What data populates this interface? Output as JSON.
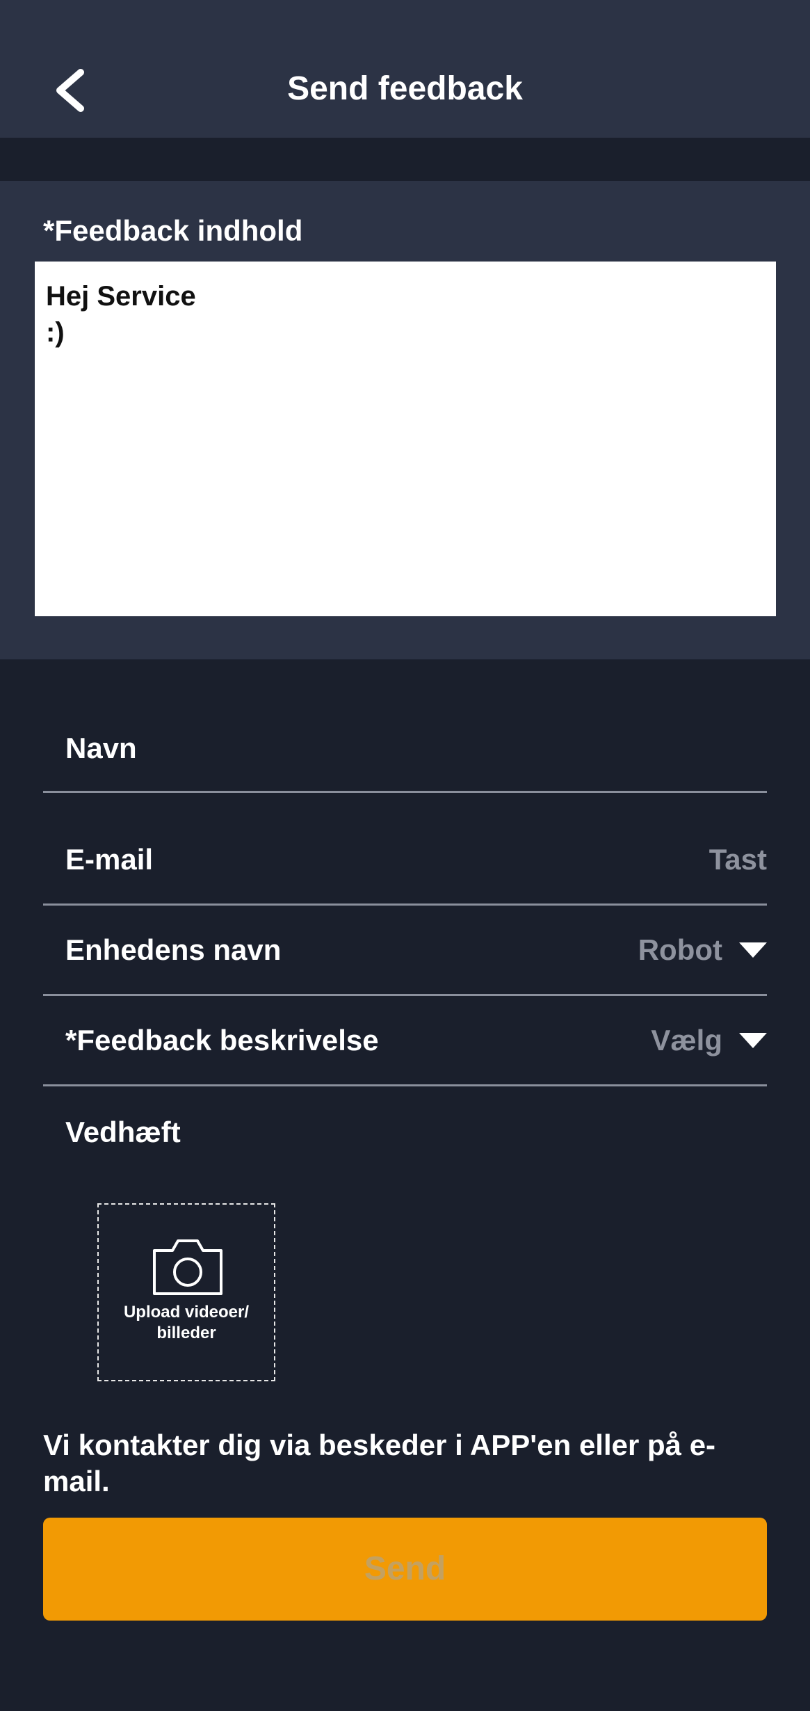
{
  "header": {
    "title": "Send feedback",
    "back_icon": "chevron-left-icon"
  },
  "feedback_content": {
    "label": "*Feedback indhold",
    "value": "Hej Service\n:)"
  },
  "form": {
    "name_label": "Navn",
    "email_label": "E-mail",
    "email_placeholder": "Tast",
    "device_label": "Enhedens navn",
    "device_value": "Robot",
    "description_label": "*Feedback beskrivelse",
    "description_value": "Vælg"
  },
  "attachments": {
    "label": "Vedhæft",
    "upload_text": "Upload videoer/\nbilleder",
    "upload_icon": "camera-icon"
  },
  "contact_note": "Vi kontakter dig via beskeder i APP'en eller på e-mail.",
  "send_label": "Send",
  "colors": {
    "background": "#1a1f2c",
    "panel": "#2c3345",
    "accent": "#f29a04",
    "muted_text": "#8e929e"
  }
}
